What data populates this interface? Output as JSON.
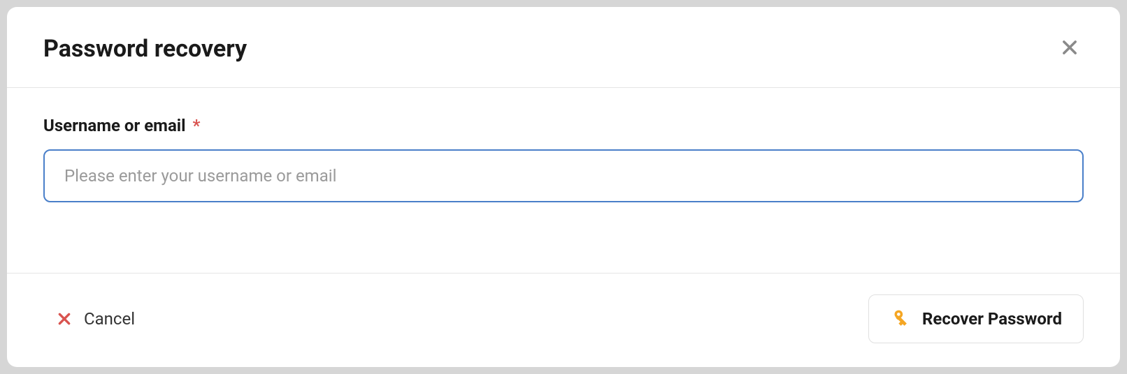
{
  "modal": {
    "title": "Password recovery",
    "form": {
      "username_label": "Username or email",
      "required_mark": "*",
      "username_placeholder": "Please enter your username or email",
      "username_value": ""
    },
    "actions": {
      "cancel_label": "Cancel",
      "recover_label": "Recover Password"
    }
  }
}
